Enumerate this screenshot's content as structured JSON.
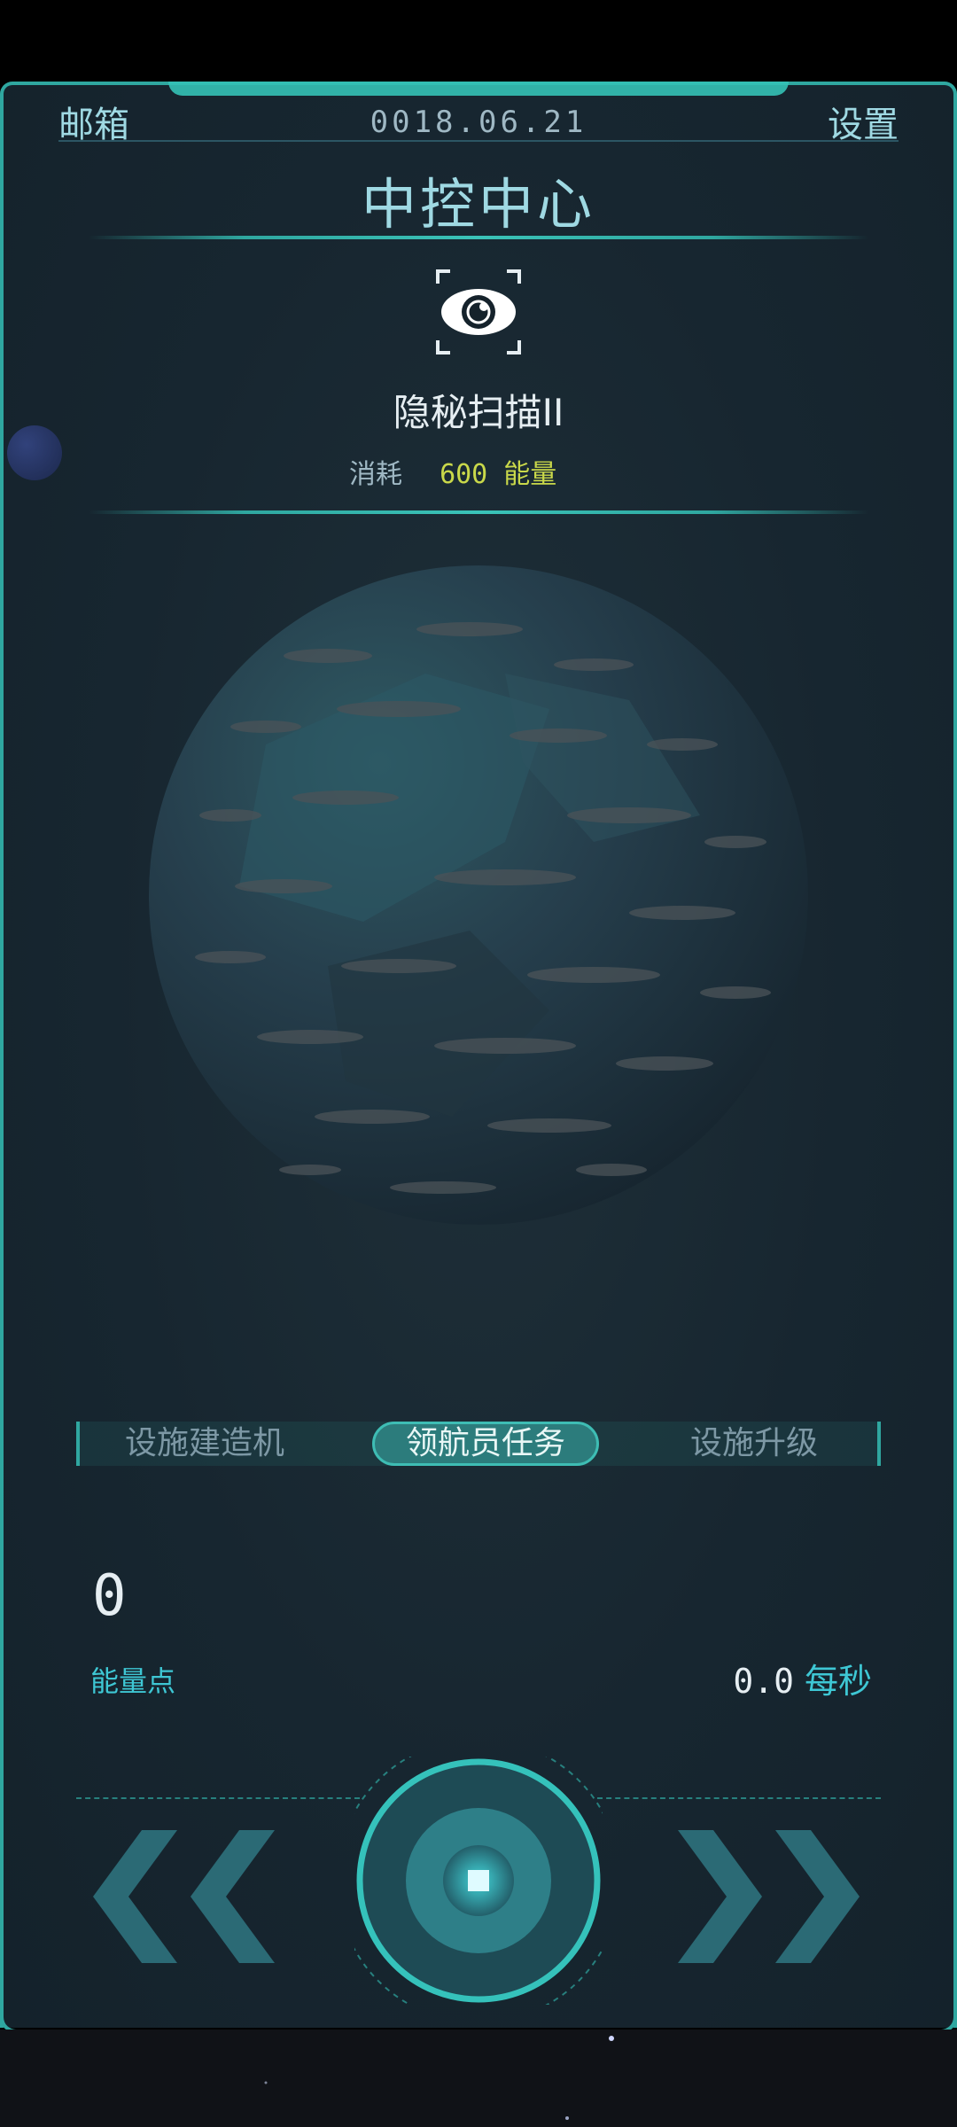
{
  "header": {
    "mailbox_label": "邮箱",
    "date": "0018.06.21",
    "settings_label": "设置"
  },
  "title": "中控中心",
  "skill": {
    "icon": "eye-scan-icon",
    "name": "隐秘扫描II",
    "cost_label": "消耗",
    "cost_value": "600 能量"
  },
  "tabs": [
    {
      "label": "设施建造机",
      "active": false
    },
    {
      "label": "领航员任务",
      "active": true
    },
    {
      "label": "设施升级",
      "active": false
    }
  ],
  "energy": {
    "value": "0",
    "label": "能量点",
    "rate_value": "0.0",
    "rate_unit": "每秒"
  },
  "controls": {
    "left_icon": "double-chevron-left-icon",
    "center_icon": "core-button-icon",
    "right_icon": "double-chevron-right-icon"
  },
  "colors": {
    "accent": "#2fa7a0",
    "accent_light": "#3ec7d4",
    "cost_yellow": "#c9d84a",
    "panel_bg": "#172630"
  }
}
